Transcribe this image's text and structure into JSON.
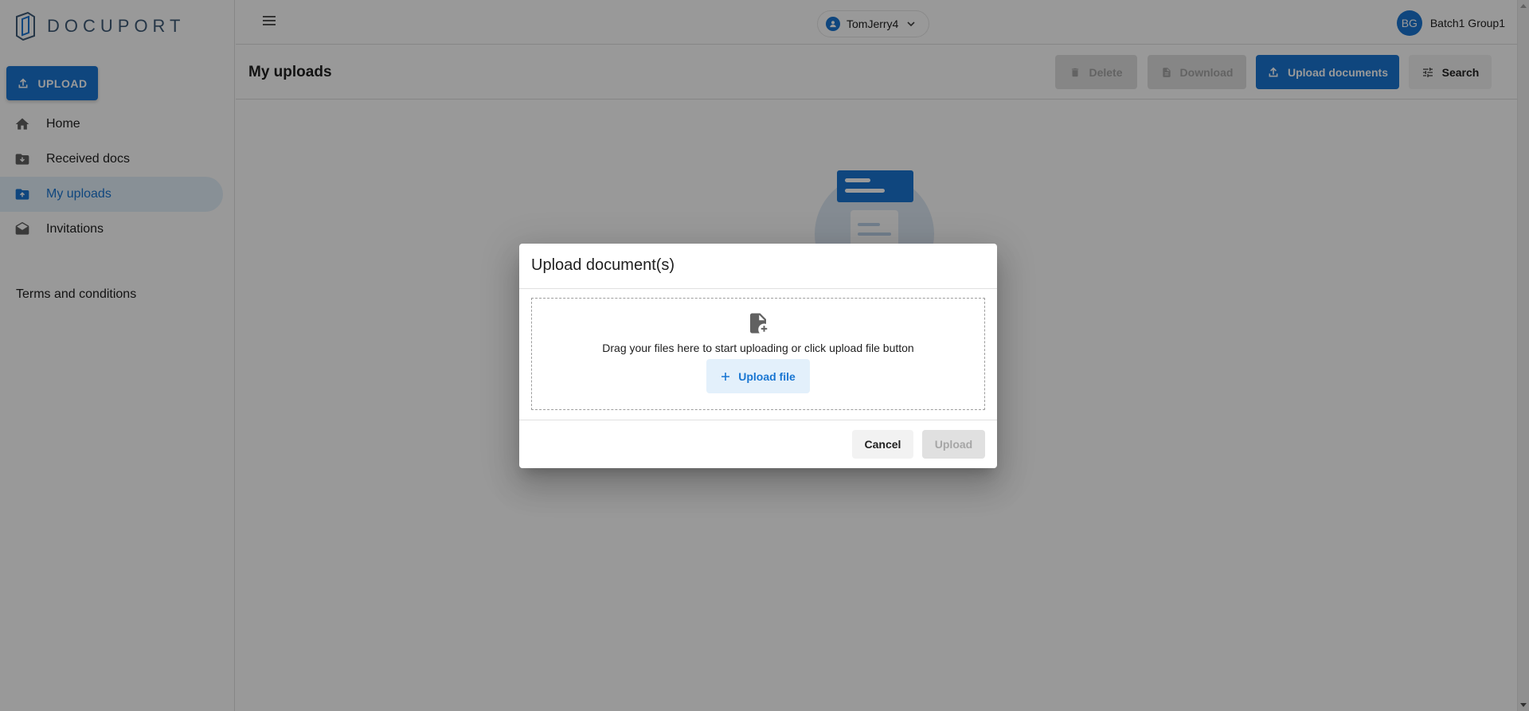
{
  "app": {
    "logo_text": "DOCUPORT"
  },
  "sidebar": {
    "upload_label": "UPLOAD",
    "items": [
      {
        "label": "Home",
        "icon": "home-icon"
      },
      {
        "label": "Received docs",
        "icon": "folder-download-icon"
      },
      {
        "label": "My uploads",
        "icon": "folder-upload-icon",
        "active": true
      },
      {
        "label": "Invitations",
        "icon": "envelope-open-icon"
      }
    ],
    "terms_label": "Terms and conditions"
  },
  "topbar": {
    "account_name": "TomJerry4",
    "user_initials": "BG",
    "user_name": "Batch1 Group1"
  },
  "toolbar": {
    "page_title": "My uploads",
    "delete_label": "Delete",
    "download_label": "Download",
    "upload_documents_label": "Upload documents",
    "search_label": "Search"
  },
  "modal": {
    "title": "Upload document(s)",
    "drop_text": "Drag your files here to start uploading or click upload file button",
    "upload_file_label": "Upload file",
    "cancel_label": "Cancel",
    "upload_label": "Upload"
  },
  "colors": {
    "primary": "#1976d2",
    "active_bg": "#e3f0fb",
    "disabled_bg": "#e0e0e0",
    "overlay": "rgba(0,0,0,0.4)"
  }
}
